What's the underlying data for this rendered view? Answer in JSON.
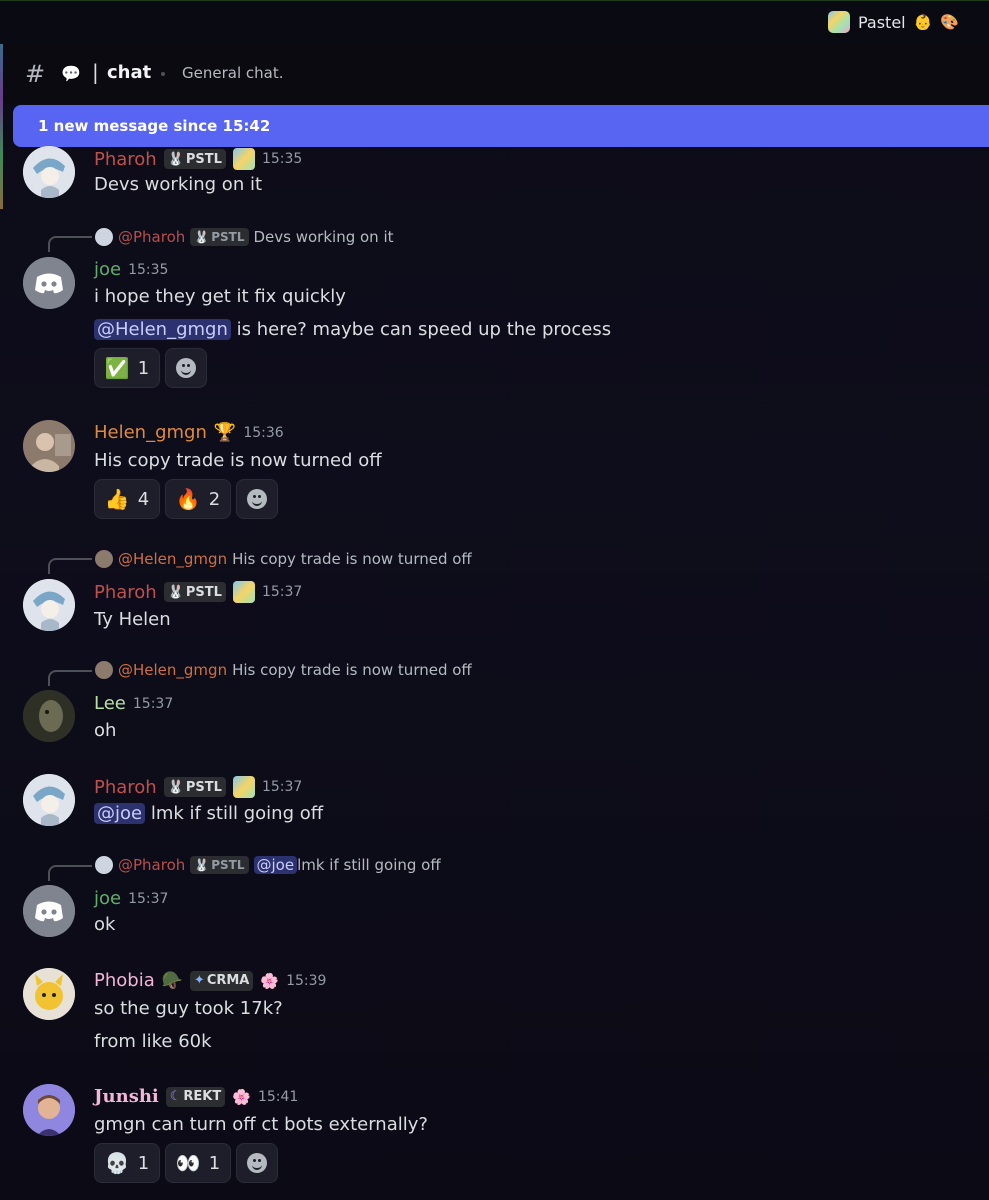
{
  "server": {
    "name": "Pastel",
    "emoji1": "👶",
    "emoji2": "🎨"
  },
  "channel": {
    "name": "chat",
    "topic": "General chat."
  },
  "banner": {
    "text": "1 new message since 15:42"
  },
  "colors": {
    "pharoh": "#c0504d",
    "joe": "#5fae6e",
    "helen": "#e08a3c",
    "lee": "#b7e0a6",
    "phobia": "#f2b6d6",
    "junshi": "#f2b6d6",
    "accent": "#5865f2"
  },
  "messages": [
    {
      "author": "Pharoh",
      "tag": "PSTL",
      "time": "15:35",
      "text": "Devs working on it"
    },
    {
      "reply": {
        "author": "@Pharoh",
        "tag": "PSTL",
        "text": "Devs working on it"
      },
      "author": "joe",
      "time": "15:35",
      "text": "i hope they get it fix quickly",
      "text2_mention": "@Helen_gmgn",
      "text2": " is here? maybe can speed up the process",
      "reactions": [
        {
          "emoji": "✅",
          "count": "1"
        }
      ]
    },
    {
      "author": "Helen_gmgn",
      "badge": "🏆",
      "time": "15:36",
      "text": "His copy trade is now turned off",
      "reactions": [
        {
          "emoji": "👍",
          "count": "4"
        },
        {
          "emoji": "🔥",
          "count": "2"
        }
      ]
    },
    {
      "reply": {
        "author": "@Helen_gmgn",
        "text": "His copy trade is now turned off"
      },
      "author": "Pharoh",
      "tag": "PSTL",
      "time": "15:37",
      "text": "Ty Helen"
    },
    {
      "reply": {
        "author": "@Helen_gmgn",
        "text": "His copy trade is now turned off"
      },
      "author": "Lee",
      "time": "15:37",
      "text": "oh"
    },
    {
      "author": "Pharoh",
      "tag": "PSTL",
      "time": "15:37",
      "mention": "@joe",
      "text": " lmk if still going off"
    },
    {
      "reply": {
        "author": "@Pharoh",
        "tag": "PSTL",
        "mention": "@joe",
        "text": " lmk if still going off"
      },
      "author": "joe",
      "time": "15:37",
      "text": "ok"
    },
    {
      "author": "Phobia",
      "badge": "🪖",
      "tag": "CRMA",
      "badge2": "🌸",
      "time": "15:39",
      "text": "so the guy took 17k?",
      "text2": "from like 60k"
    },
    {
      "author": "Junshi",
      "tag": "REKT",
      "badge2": "🌸",
      "time": "15:41",
      "text": "gmgn can turn off ct bots externally?",
      "reactions": [
        {
          "emoji": "💀",
          "count": "1"
        },
        {
          "emoji": "👀",
          "count": "1"
        }
      ]
    }
  ]
}
